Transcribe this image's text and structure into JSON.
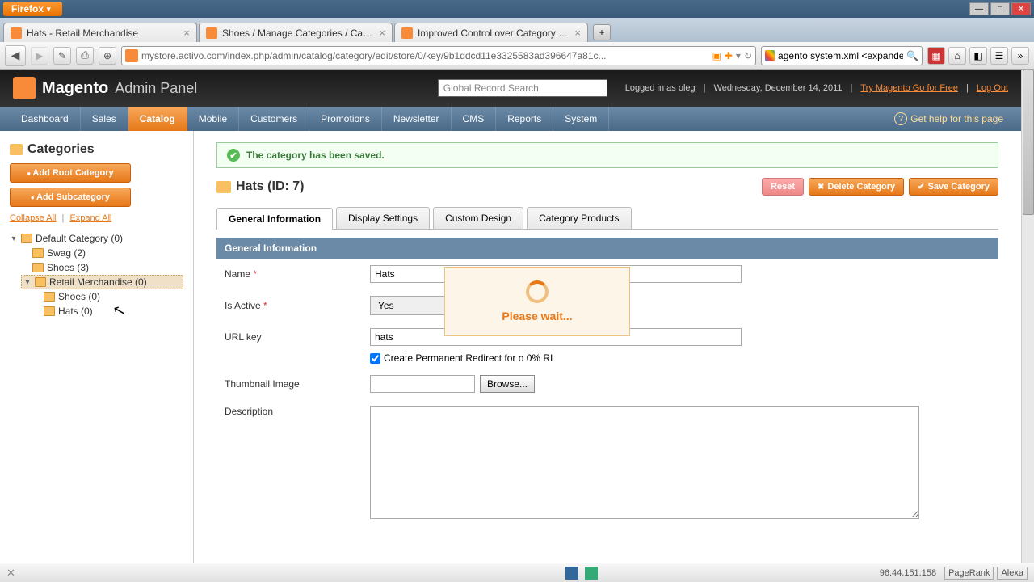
{
  "browser": {
    "app_button": "Firefox",
    "tabs": [
      {
        "label": "Hats - Retail Merchandise"
      },
      {
        "label": "Shoes / Manage Categories / Categor..."
      },
      {
        "label": "Improved Control over Category URL ..."
      }
    ],
    "url": "mystore.activo.com/index.php/admin/catalog/category/edit/store/0/key/9b1ddcd11e3325583ad396647a81c...",
    "search_value": "agento system.xml <expanded>",
    "status_ip": "96.44.151.158",
    "status_pagerank": "PageRank",
    "status_alexa": "Alexa"
  },
  "magento": {
    "brand": "Magento",
    "brand_sub": "Admin Panel",
    "global_search_placeholder": "Global Record Search",
    "logged_in": "Logged in as oleg",
    "date": "Wednesday, December 14, 2011",
    "try_link": "Try Magento Go for Free",
    "logout": "Log Out",
    "help": "Get help for this page",
    "menu": [
      "Dashboard",
      "Sales",
      "Catalog",
      "Mobile",
      "Customers",
      "Promotions",
      "Newsletter",
      "CMS",
      "Reports",
      "System"
    ],
    "menu_active_index": 2
  },
  "sidebar": {
    "title": "Categories",
    "add_root": "Add Root Category",
    "add_sub": "Add Subcategory",
    "collapse": "Collapse All",
    "expand": "Expand All",
    "tree": {
      "root": "Default Category (0)",
      "swag": "Swag (2)",
      "shoes1": "Shoes (3)",
      "retail": "Retail Merchandise (0)",
      "shoes2": "Shoes (0)",
      "hats": "Hats (0)"
    }
  },
  "content": {
    "success_msg": "The category has been saved.",
    "title": "Hats (ID: 7)",
    "btn_reset": "Reset",
    "btn_delete": "Delete Category",
    "btn_save": "Save Category",
    "tabs": [
      "General Information",
      "Display Settings",
      "Custom Design",
      "Category Products"
    ],
    "section": "General Information",
    "fields": {
      "name_label": "Name",
      "name_value": "Hats",
      "active_label": "Is Active",
      "active_value": "Yes",
      "url_label": "URL key",
      "url_value": "hats",
      "redirect_label": "Create Permanent Redirect for o 0% RL",
      "thumb_label": "Thumbnail Image",
      "browse": "Browse...",
      "desc_label": "Description"
    },
    "overlay": "Please wait..."
  }
}
